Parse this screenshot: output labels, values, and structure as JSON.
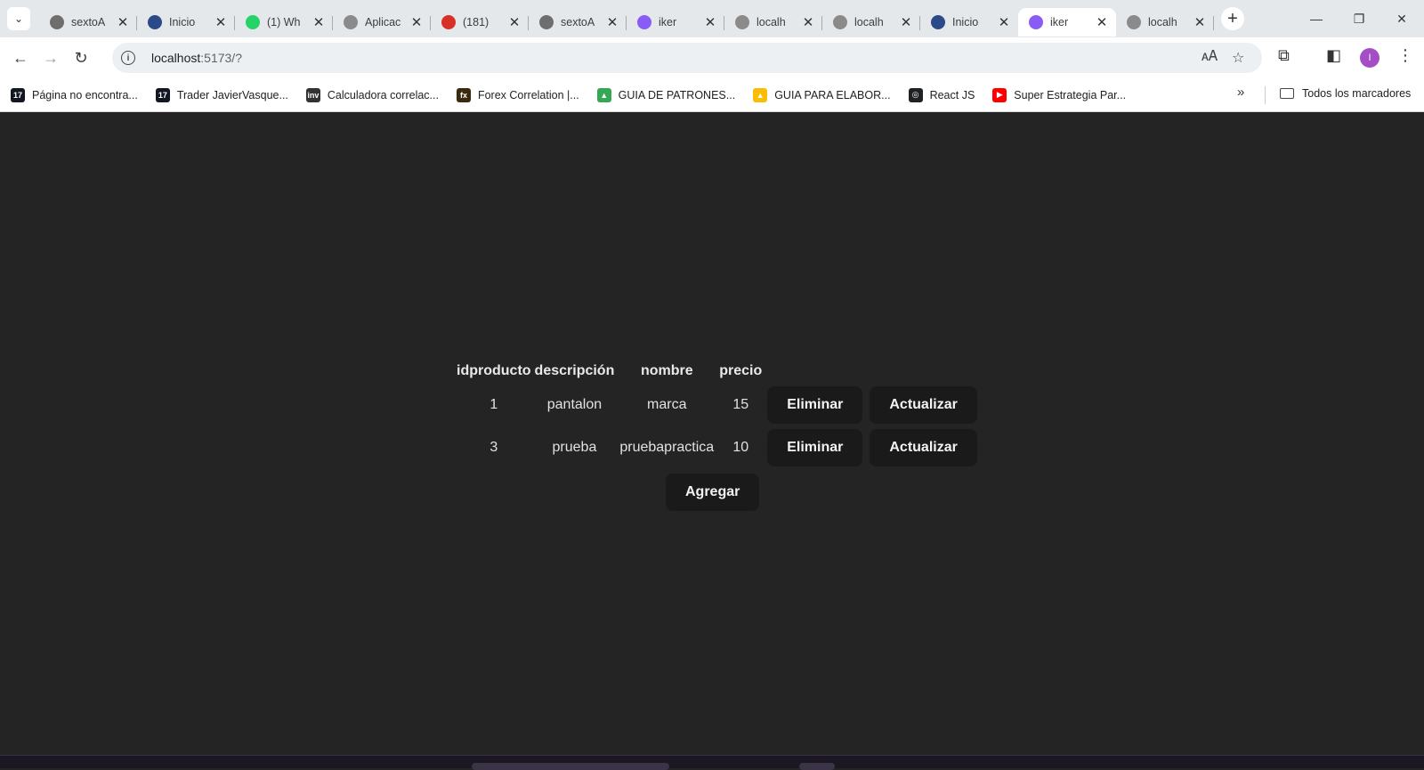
{
  "browser": {
    "tabs": [
      {
        "title": "sextoA",
        "icon": "github-icon",
        "color": "#6e6e6e"
      },
      {
        "title": "Inicio",
        "icon": "mountain-icon",
        "color": "#2b4a8a"
      },
      {
        "title": "(1) Wh",
        "icon": "whatsapp-icon",
        "color": "#25d366"
      },
      {
        "title": "Aplicac",
        "icon": "globe-icon",
        "color": "#8a8a8a"
      },
      {
        "title": "(181)",
        "icon": "badge-icon",
        "color": "#d93025"
      },
      {
        "title": "sextoA",
        "icon": "github-icon",
        "color": "#6e6e6e"
      },
      {
        "title": "iker",
        "icon": "vite-icon",
        "color": "#8a5cf6"
      },
      {
        "title": "localh",
        "icon": "globe-icon",
        "color": "#8a8a8a"
      },
      {
        "title": "localh",
        "icon": "globe-icon",
        "color": "#8a8a8a"
      },
      {
        "title": "Inicio",
        "icon": "mountain-icon",
        "color": "#2b4a8a"
      },
      {
        "title": "iker",
        "icon": "vite-icon",
        "color": "#8a5cf6",
        "active": true
      },
      {
        "title": "localh",
        "icon": "globe-icon",
        "color": "#8a8a8a"
      }
    ],
    "url_host": "localhost",
    "url_rest": ":5173/?",
    "profile_initial": "I",
    "bookmarks": [
      {
        "label": "Página no encontra...",
        "icon": "tradingview-icon",
        "color": "#131722",
        "glyph": "17"
      },
      {
        "label": "Trader JavierVasque...",
        "icon": "tradingview-icon",
        "color": "#131722",
        "glyph": "17"
      },
      {
        "label": "Calculadora correlac...",
        "icon": "investing-icon",
        "color": "#333333",
        "glyph": "inv"
      },
      {
        "label": "Forex Correlation |...",
        "icon": "fx-icon",
        "color": "#3a2a10",
        "glyph": "fx"
      },
      {
        "label": "GUIA DE PATRONES...",
        "icon": "drive-icon",
        "color": "#34a853",
        "glyph": "▲"
      },
      {
        "label": "GUIA PARA ELABOR...",
        "icon": "drive-icon",
        "color": "#fbbc04",
        "glyph": "▲"
      },
      {
        "label": "React JS",
        "icon": "globe-icon",
        "color": "#202124",
        "glyph": "◎"
      },
      {
        "label": "Super Estrategia Par...",
        "icon": "youtube-icon",
        "color": "#ff0000",
        "glyph": "▶"
      }
    ],
    "all_bookmarks_label": "Todos los marcadores"
  },
  "products": {
    "headers": [
      "idproducto",
      "descripción",
      "nombre",
      "precio"
    ],
    "rows": [
      {
        "idproducto": "1",
        "descripcion": "pantalon",
        "nombre": "marca",
        "precio": "15"
      },
      {
        "idproducto": "3",
        "descripcion": "prueba",
        "nombre": "pruebapractica",
        "precio": "10"
      }
    ],
    "delete_label": "Eliminar",
    "update_label": "Actualizar",
    "add_label": "Agregar"
  },
  "colors": {
    "page_bg": "#242424",
    "button_bg": "#1a1a1a",
    "profile": "#a44ec6"
  }
}
